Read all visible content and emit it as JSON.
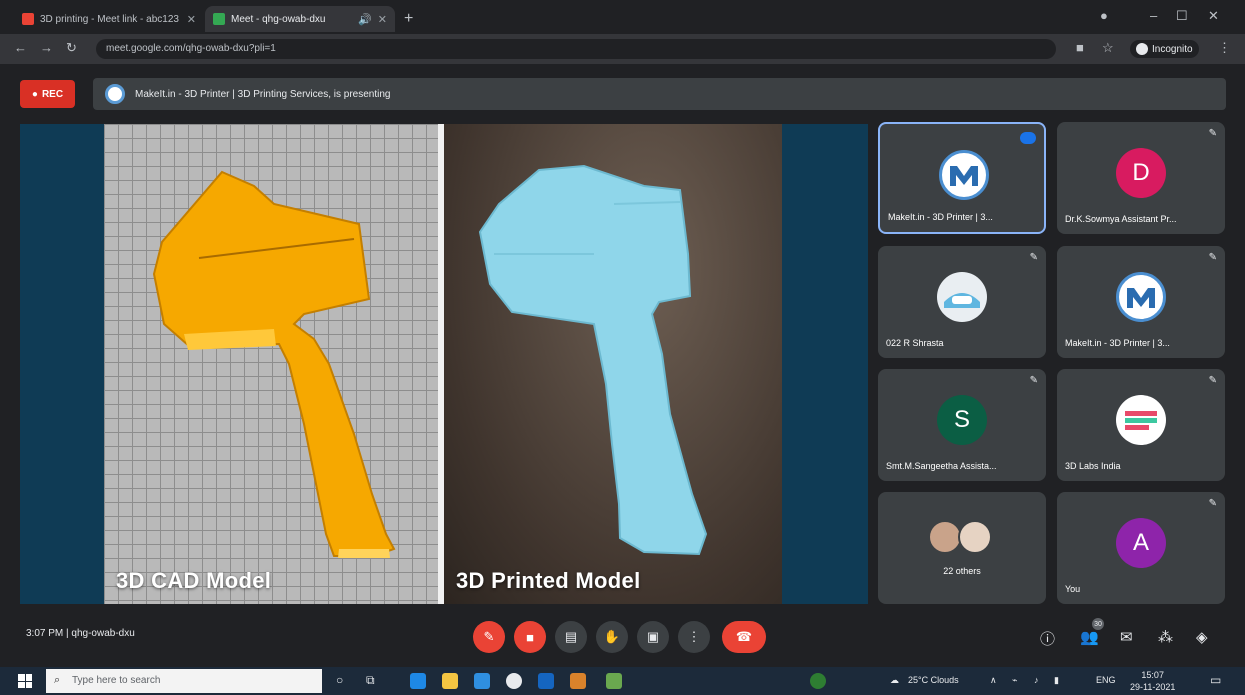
{
  "browser": {
    "tabs": [
      {
        "label": "3D printing - Meet link - abc123",
        "active": false,
        "favicon_color": "#ea4335"
      },
      {
        "label": "Meet - qhg-owab-dxu",
        "active": true,
        "favicon_color": "#34a853"
      }
    ],
    "url": "meet.google.com/qhg-owab-dxu?pli=1",
    "profile_label": "Incognito"
  },
  "meet": {
    "rec_label": "REC",
    "presenting_text": "MakeIt.in - 3D Printer | 3D Printing Services, is presenting",
    "stage": {
      "caption_left": "3D CAD Model",
      "caption_right": "3D Printed Model"
    },
    "participants": [
      {
        "name": "MakeIt.in - 3D Printer | 3...",
        "avatar": "logo",
        "active": true
      },
      {
        "name": "Dr.K.Sowmya Assistant Pr...",
        "avatar": "D",
        "avatar_color": "#d81b60"
      },
      {
        "name": "022 R Shrasta",
        "avatar": "photo"
      },
      {
        "name": "MakeIt.in - 3D Printer | 3...",
        "avatar": "logo"
      },
      {
        "name": "Smt.M.Sangeetha Assista...",
        "avatar": "S",
        "avatar_color": "#0b5e44"
      },
      {
        "name": "3D Labs India",
        "avatar": "photo"
      },
      {
        "name": "22 others",
        "avatar": "group"
      },
      {
        "name": "You",
        "avatar": "A",
        "avatar_color": "#8e24aa"
      }
    ],
    "time": "3:07 PM",
    "meeting_code": "qhg-owab-dxu",
    "people_count": "30"
  },
  "taskbar": {
    "search_placeholder": "Type here to search",
    "weather": "25°C Clouds",
    "clock_time": "15:07",
    "clock_date": "29-11-2021",
    "lang": "ENG"
  }
}
